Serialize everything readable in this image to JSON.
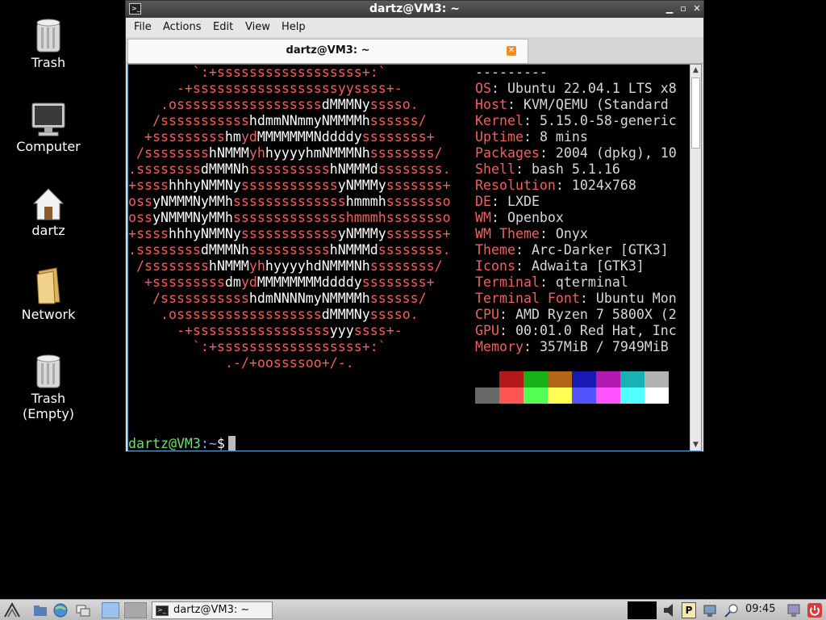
{
  "desktop": {
    "icons": [
      {
        "label": "Trash",
        "icon": "trash-icon"
      },
      {
        "label": "Computer",
        "icon": "computer-icon"
      },
      {
        "label": "dartz",
        "icon": "home-icon"
      },
      {
        "label": "Network",
        "icon": "network-folder-icon"
      },
      {
        "label": "Trash\n(Empty)",
        "icon": "trash-empty-icon"
      }
    ]
  },
  "window": {
    "title": "dartz@VM3: ~",
    "menu": [
      "File",
      "Actions",
      "Edit",
      "View",
      "Help"
    ],
    "tab_label": "dartz@VM3: ~"
  },
  "terminal": {
    "logo": [
      [
        [
          "r",
          "        `:+ssssssssssssssssss+:`"
        ]
      ],
      [
        [
          "r",
          "      -+ssssssssssssssssssyyssss+-"
        ]
      ],
      [
        [
          "r",
          "    .ossssssssssssssssss"
        ],
        [
          "w",
          "dMMMNy"
        ],
        [
          "r",
          "sssso."
        ]
      ],
      [
        [
          "r",
          "   /sssssssssss"
        ],
        [
          "w",
          "hdmmNNmmyNMMMMh"
        ],
        [
          "r",
          "ssssss/"
        ]
      ],
      [
        [
          "r",
          "  +sssssssss"
        ],
        [
          "w",
          "hm"
        ],
        [
          "r",
          "yd"
        ],
        [
          "w",
          "MMMMMMMNddddy"
        ],
        [
          "r",
          "ssssssss+"
        ]
      ],
      [
        [
          "r",
          " /ssssssss"
        ],
        [
          "w",
          "hNMMM"
        ],
        [
          "r",
          "yh"
        ],
        [
          "w",
          "hyyyyhmNMMMNh"
        ],
        [
          "r",
          "ssssssss/"
        ]
      ],
      [
        [
          "r",
          ".ssssssss"
        ],
        [
          "w",
          "dMMMNh"
        ],
        [
          "r",
          "ssssssssss"
        ],
        [
          "w",
          "hNMMMd"
        ],
        [
          "r",
          "ssssssss."
        ]
      ],
      [
        [
          "r",
          "+ssss"
        ],
        [
          "w",
          "hhhyNMMNy"
        ],
        [
          "r",
          "ssssssssssss"
        ],
        [
          "w",
          "yNMMMy"
        ],
        [
          "r",
          "sssssss+"
        ]
      ],
      [
        [
          "r",
          "oss"
        ],
        [
          "w",
          "yNMMMNyMMh"
        ],
        [
          "r",
          "ssssssssssssss"
        ],
        [
          "w",
          "hmmmh"
        ],
        [
          "r",
          "ssssssso"
        ]
      ],
      [
        [
          "r",
          "oss"
        ],
        [
          "w",
          "yNMMMNyMMh"
        ],
        [
          "r",
          "sssssssssssssshmmmhssssssso"
        ]
      ],
      [
        [
          "r",
          "+ssss"
        ],
        [
          "w",
          "hhhyNMMNy"
        ],
        [
          "r",
          "ssssssssssss"
        ],
        [
          "w",
          "yNMMMy"
        ],
        [
          "r",
          "sssssss+"
        ]
      ],
      [
        [
          "r",
          ".ssssssss"
        ],
        [
          "w",
          "dMMMNh"
        ],
        [
          "r",
          "ssssssssss"
        ],
        [
          "w",
          "hNMMMd"
        ],
        [
          "r",
          "ssssssss."
        ]
      ],
      [
        [
          "r",
          " /ssssssss"
        ],
        [
          "w",
          "hNMMM"
        ],
        [
          "r",
          "yh"
        ],
        [
          "w",
          "hyyyyhdNMMMNh"
        ],
        [
          "r",
          "ssssssss/"
        ]
      ],
      [
        [
          "r",
          "  +sssssssss"
        ],
        [
          "w",
          "dm"
        ],
        [
          "r",
          "yd"
        ],
        [
          "w",
          "MMMMMMMMddddy"
        ],
        [
          "r",
          "ssssssss+"
        ]
      ],
      [
        [
          "r",
          "   /sssssssssss"
        ],
        [
          "w",
          "hdmNNNNmyNMMMMh"
        ],
        [
          "r",
          "ssssss/"
        ]
      ],
      [
        [
          "r",
          "    .ossssssssssssssssss"
        ],
        [
          "w",
          "dMMMNy"
        ],
        [
          "r",
          "sssso."
        ]
      ],
      [
        [
          "r",
          "      -+sssssssssssssssss"
        ],
        [
          "w",
          "yyy"
        ],
        [
          "r",
          "ssss+-"
        ]
      ],
      [
        [
          "r",
          "        `:+ssssssssssssssssss+:`"
        ]
      ],
      [
        [
          "r",
          "            .-/+oossssoo+/-."
        ]
      ]
    ],
    "separator": "---------",
    "info": [
      {
        "key": "OS",
        "value": "Ubuntu 22.04.1 LTS x8"
      },
      {
        "key": "Host",
        "value": "KVM/QEMU (Standard"
      },
      {
        "key": "Kernel",
        "value": "5.15.0-58-generic"
      },
      {
        "key": "Uptime",
        "value": "8 mins"
      },
      {
        "key": "Packages",
        "value": "2004 (dpkg), 10"
      },
      {
        "key": "Shell",
        "value": "bash 5.1.16"
      },
      {
        "key": "Resolution",
        "value": "1024x768"
      },
      {
        "key": "DE",
        "value": "LXDE"
      },
      {
        "key": "WM",
        "value": "Openbox"
      },
      {
        "key": "WM Theme",
        "value": "Onyx"
      },
      {
        "key": "Theme",
        "value": "Arc-Darker [GTK3]"
      },
      {
        "key": "Icons",
        "value": "Adwaita [GTK3]"
      },
      {
        "key": "Terminal",
        "value": "qterminal"
      },
      {
        "key": "Terminal Font",
        "value": "Ubuntu Mon"
      },
      {
        "key": "CPU",
        "value": "AMD Ryzen 7 5800X (2"
      },
      {
        "key": "GPU",
        "value": "00:01.0 Red Hat, Inc"
      },
      {
        "key": "Memory",
        "value": "357MiB / 7949MiB"
      }
    ],
    "palette_dark": [
      "#000000",
      "#b21818",
      "#18b218",
      "#b26818",
      "#1818b2",
      "#b218b2",
      "#18b2b2",
      "#b2b2b2"
    ],
    "palette_bright": [
      "#686868",
      "#ff5454",
      "#54ff54",
      "#ffff54",
      "#5454ff",
      "#ff54ff",
      "#54ffff",
      "#ffffff"
    ],
    "prompt_user": "dartz@VM3",
    "prompt_path": ":~",
    "prompt_symbol": "$"
  },
  "taskbar": {
    "task_label": "dartz@VM3: ~",
    "clock": "09:45"
  }
}
